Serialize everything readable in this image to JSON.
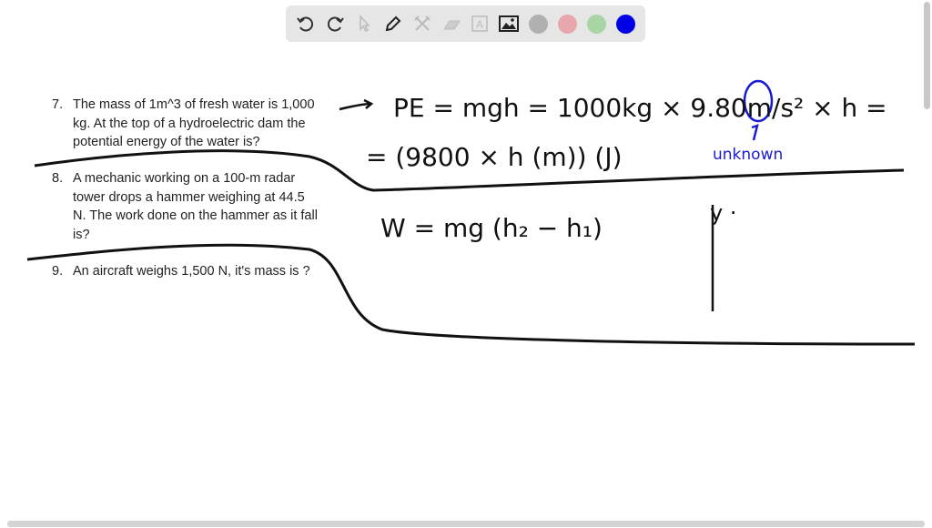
{
  "toolbar": {
    "tools": [
      "undo-icon",
      "redo-icon",
      "select-icon",
      "pen-icon",
      "tools-icon",
      "eraser-icon",
      "text-icon",
      "image-icon"
    ],
    "colors": [
      "#b0b0b0",
      "#e8a6ad",
      "#a9d4a6",
      "#0000e6"
    ],
    "text_icon_label": "A"
  },
  "questions": [
    {
      "number": "7.",
      "lines": [
        "The mass of 1m^3 of fresh water is 1,000",
        "kg. At the top of a hydroelectric dam the",
        "potential energy of the water is?"
      ]
    },
    {
      "number": "8.",
      "lines": [
        "A mechanic working on a 100-m radar",
        "tower drops a hammer weighing at 44.5",
        "N. The work done on the hammer as it fall",
        "is?"
      ]
    },
    {
      "number": "9.",
      "lines": [
        "An aircraft weighs 1,500 N, it's mass is ?"
      ]
    }
  ],
  "handwriting": {
    "line1": "PE = mgh = 1000kg × 9.80m/s² × h =",
    "line2": "= (9800 × h (m)) (J)",
    "annotation": "unknown",
    "line3": "W = mg (h₂ − h₁)",
    "side": "y ·"
  }
}
